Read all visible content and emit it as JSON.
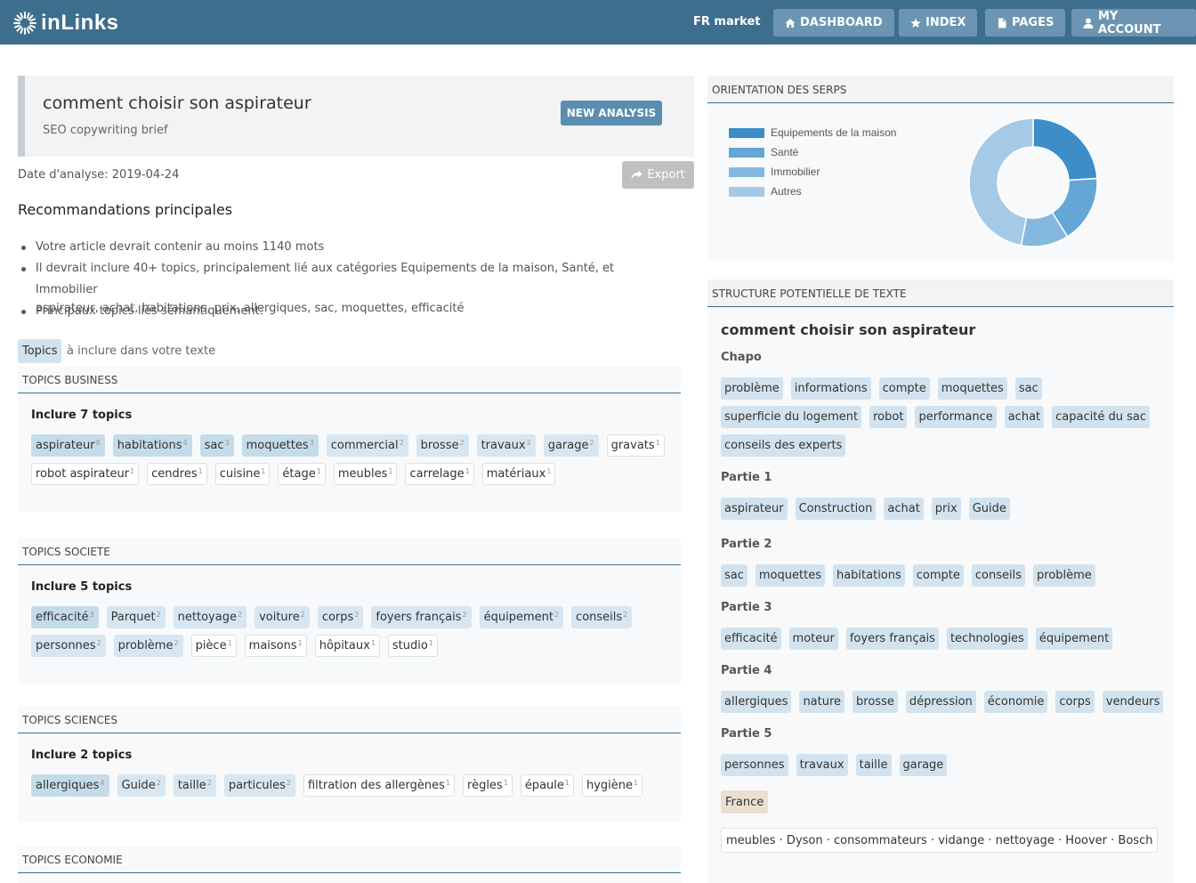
{
  "navbar": {
    "logo_text": "inLinks",
    "market": "FR market",
    "buttons": [
      {
        "label": "DASHBOARD",
        "icon": "home-icon"
      },
      {
        "label": "INDEX",
        "icon": "star-icon"
      },
      {
        "label": "PAGES",
        "icon": "file-icon"
      },
      {
        "label": "MY ACCOUNT",
        "icon": "user-icon"
      }
    ]
  },
  "header": {
    "title": "comment choisir son aspirateur",
    "subtitle": "SEO copywriting brief",
    "new_analysis_label": "NEW ANALYSIS"
  },
  "date_label": "Date d'analyse: 2019-04-24",
  "export_label": "Export",
  "recommendations": {
    "title": "Recommandations principales",
    "items": [
      "Votre article devrait contenir au moins 1140 mots",
      "Il devrait inclure 40+ topics, principalement lié aux catégories Equipements de la maison, Santé, et Immobilier",
      "Principaux topics liés sémantiquement:",
      "aspirateur, achat, habitations, prix, allergiques, sac, moquettes, efficacité"
    ]
  },
  "topics_chip": "Topics",
  "topics_desc": "à inclure dans votre texte",
  "panels": [
    {
      "title": "TOPICS BUSINESS",
      "include": "Inclure 7 topics",
      "tags": [
        {
          "t": "aspirateur",
          "n": "8",
          "lvl": 3
        },
        {
          "t": "habitations",
          "n": "4",
          "lvl": 3
        },
        {
          "t": "sac",
          "n": "3",
          "lvl": 3
        },
        {
          "t": "moquettes",
          "n": "3",
          "lvl": 3
        },
        {
          "t": "commercial",
          "n": "2",
          "lvl": 2
        },
        {
          "t": "brosse",
          "n": "2",
          "lvl": 2
        },
        {
          "t": "travaux",
          "n": "2",
          "lvl": 2
        },
        {
          "t": "garage",
          "n": "2",
          "lvl": 2
        },
        {
          "t": "gravats",
          "n": "1",
          "lvl": 1
        },
        {
          "t": "robot aspirateur",
          "n": "1",
          "lvl": 1
        },
        {
          "t": "cendres",
          "n": "1",
          "lvl": 1
        },
        {
          "t": "cuisine",
          "n": "1",
          "lvl": 1
        },
        {
          "t": "étage",
          "n": "1",
          "lvl": 1
        },
        {
          "t": "meubles",
          "n": "1",
          "lvl": 1
        },
        {
          "t": "carrelage",
          "n": "1",
          "lvl": 1
        },
        {
          "t": "matériaux",
          "n": "1",
          "lvl": 1
        }
      ]
    },
    {
      "title": "TOPICS SOCIETE",
      "include": "Inclure 5 topics",
      "tags": [
        {
          "t": "efficacité",
          "n": "3",
          "lvl": 3
        },
        {
          "t": "Parquet",
          "n": "2",
          "lvl": 2
        },
        {
          "t": "nettoyage",
          "n": "2",
          "lvl": 2
        },
        {
          "t": "voiture",
          "n": "2",
          "lvl": 2
        },
        {
          "t": "corps",
          "n": "2",
          "lvl": 2
        },
        {
          "t": "foyers français",
          "n": "2",
          "lvl": 2
        },
        {
          "t": "équipement",
          "n": "2",
          "lvl": 2
        },
        {
          "t": "conseils",
          "n": "2",
          "lvl": 2
        },
        {
          "t": "personnes",
          "n": "2",
          "lvl": 2
        },
        {
          "t": "problème",
          "n": "2",
          "lvl": 2
        },
        {
          "t": "pièce",
          "n": "1",
          "lvl": 1
        },
        {
          "t": "maisons",
          "n": "1",
          "lvl": 1
        },
        {
          "t": "hôpitaux",
          "n": "1",
          "lvl": 1
        },
        {
          "t": "studio",
          "n": "1",
          "lvl": 1
        }
      ]
    },
    {
      "title": "TOPICS SCIENCES",
      "include": "Inclure 2 topics",
      "tags": [
        {
          "t": "allergiques",
          "n": "4",
          "lvl": 3
        },
        {
          "t": "Guide",
          "n": "2",
          "lvl": 2
        },
        {
          "t": "taille",
          "n": "2",
          "lvl": 2
        },
        {
          "t": "particules",
          "n": "2",
          "lvl": 2
        },
        {
          "t": "filtration des allergènes",
          "n": "1",
          "lvl": 1
        },
        {
          "t": "règles",
          "n": "1",
          "lvl": 1
        },
        {
          "t": "épaule",
          "n": "1",
          "lvl": 1
        },
        {
          "t": "hygiène",
          "n": "1",
          "lvl": 1
        }
      ]
    },
    {
      "title": "TOPICS ECONOMIE",
      "include": "",
      "tags": []
    }
  ],
  "serps": {
    "title": "ORIENTATION DES SERPS",
    "legend": [
      {
        "label": "Equipements de la maison",
        "color": "#3c8dc8"
      },
      {
        "label": "Santé",
        "color": "#64a6d6"
      },
      {
        "label": "Immobilier",
        "color": "#85b8df"
      },
      {
        "label": "Autres",
        "color": "#a5cae7"
      }
    ],
    "slices": [
      {
        "value": 24,
        "color": "#3c8dc8"
      },
      {
        "value": 17,
        "color": "#64a6d6"
      },
      {
        "value": 12,
        "color": "#85b8df"
      },
      {
        "value": 47,
        "color": "#a5cae7"
      }
    ]
  },
  "structure": {
    "title": "STRUCTURE POTENTIELLE DE TEXTE",
    "heading": "comment choisir son aspirateur",
    "sections": [
      {
        "label": "Chapo",
        "tags": [
          "problème",
          "informations",
          "compte",
          "moquettes",
          "sac",
          "superficie du logement",
          "robot",
          "performance",
          "achat",
          "capacité du sac",
          "conseils des experts"
        ]
      },
      {
        "label": "Partie 1",
        "tags": [
          "aspirateur",
          "Construction",
          "achat",
          "prix",
          "Guide"
        ]
      },
      {
        "label": "Partie 2",
        "tags": [
          "sac",
          "moquettes",
          "habitations",
          "compte",
          "conseils",
          "problème"
        ]
      },
      {
        "label": "Partie 3",
        "tags": [
          "efficacité",
          "moteur",
          "foyers français",
          "technologies",
          "équipement"
        ]
      },
      {
        "label": "Partie 4",
        "tags": [
          "allergiques",
          "nature",
          "brosse",
          "dépression",
          "économie",
          "corps",
          "vendeurs"
        ]
      },
      {
        "label": "Partie 5",
        "tags": [
          "personnes",
          "travaux",
          "taille",
          "garage"
        ]
      }
    ],
    "location_tag": "France",
    "entities": "meubles · Dyson · consommateurs · vidange · nettoyage · Hoover · Bosch"
  }
}
